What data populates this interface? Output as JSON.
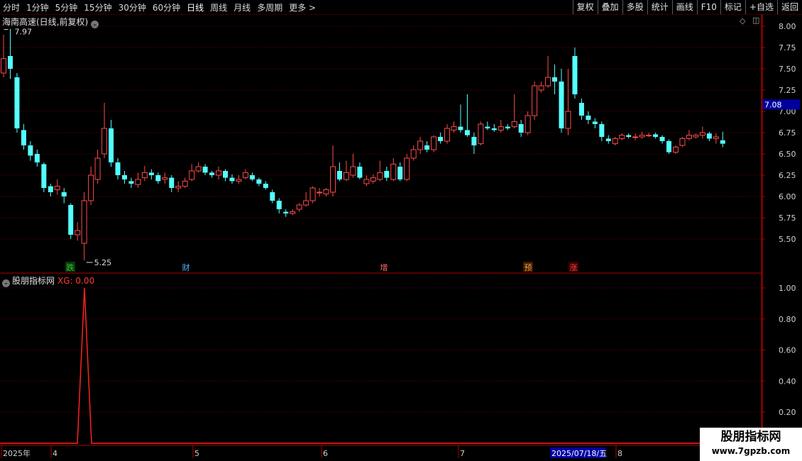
{
  "toolbar": {
    "periods": [
      "分时",
      "1分钟",
      "5分钟",
      "15分钟",
      "30分钟",
      "60分钟",
      "日线",
      "周线",
      "月线",
      "多周期",
      "更多 >"
    ],
    "active_period": "日线",
    "actions": [
      "复权",
      "叠加",
      "多股",
      "统计",
      "画线",
      "F10",
      "标记",
      "+自选",
      "返回"
    ]
  },
  "price_panel": {
    "title": "海南高速(日线,前复权)",
    "current_price_tag": "7.08",
    "high_marker": "7.97",
    "low_marker": "5.25",
    "y_ticks": [
      "8.00",
      "7.75",
      "7.50",
      "7.25",
      "7.00",
      "6.75",
      "6.50",
      "6.25",
      "6.00",
      "5.75",
      "5.50"
    ],
    "event_markers": [
      {
        "label": "跌",
        "color": "#35c635",
        "bg": "#0a3a0a"
      },
      {
        "label": "财",
        "color": "#5ab0ff",
        "bg": "#000000"
      },
      {
        "label": "增",
        "color": "#ff6b6b",
        "bg": "#000000"
      },
      {
        "label": "预",
        "color": "#ff9a3c",
        "bg": "#3a1a00"
      },
      {
        "label": "涨",
        "color": "#ff4040",
        "bg": "#3a0000"
      }
    ]
  },
  "indicator_panel": {
    "name": "股朋指标网",
    "formula": "XG: 0.00",
    "y_ticks": [
      "1.00",
      "0.80",
      "0.60",
      "0.40",
      "0.20"
    ]
  },
  "x_axis": {
    "labels": [
      "2025年",
      "4",
      "5",
      "6",
      "7",
      "8"
    ],
    "cursor_date": "2025/07/18/五"
  },
  "watermark": {
    "line1": "股朋指标网",
    "line2": "www.7gpzb.com"
  },
  "colors": {
    "up": "#ff4a4a",
    "down": "#54ffff",
    "grid": "#6a0000",
    "axis": "#b00000"
  },
  "chart_data": {
    "type": "candlestick",
    "x_start": "2025-03-10",
    "x_end": "2025-08-14",
    "ylim": [
      5.25,
      8.0
    ],
    "candles": [
      [
        7.45,
        7.62,
        7.9,
        7.4
      ],
      [
        7.65,
        7.5,
        7.97,
        7.38
      ],
      [
        7.4,
        6.8,
        7.45,
        6.75
      ],
      [
        6.78,
        6.6,
        6.85,
        6.55
      ],
      [
        6.6,
        6.48,
        6.65,
        6.42
      ],
      [
        6.5,
        6.4,
        6.55,
        6.35
      ],
      [
        6.38,
        6.1,
        6.4,
        6.05
      ],
      [
        6.12,
        6.05,
        6.15,
        6.0
      ],
      [
        6.08,
        6.12,
        6.2,
        6.02
      ],
      [
        6.05,
        6.0,
        6.1,
        5.92
      ],
      [
        5.9,
        5.55,
        5.92,
        5.5
      ],
      [
        5.55,
        5.6,
        5.7,
        5.48
      ],
      [
        5.45,
        5.95,
        6.05,
        5.25
      ],
      [
        5.95,
        6.25,
        6.35,
        5.9
      ],
      [
        6.2,
        6.45,
        6.55,
        6.15
      ],
      [
        6.5,
        6.8,
        7.1,
        6.45
      ],
      [
        6.8,
        6.4,
        6.9,
        6.35
      ],
      [
        6.4,
        6.25,
        6.45,
        6.2
      ],
      [
        6.25,
        6.2,
        6.3,
        6.15
      ],
      [
        6.18,
        6.15,
        6.22,
        6.1
      ],
      [
        6.14,
        6.2,
        6.28,
        6.1
      ],
      [
        6.22,
        6.28,
        6.36,
        6.18
      ],
      [
        6.28,
        6.25,
        6.32,
        6.2
      ],
      [
        6.25,
        6.18,
        6.28,
        6.15
      ],
      [
        6.2,
        6.22,
        6.28,
        6.15
      ],
      [
        6.22,
        6.1,
        6.25,
        6.05
      ],
      [
        6.1,
        6.12,
        6.18,
        6.05
      ],
      [
        6.12,
        6.18,
        6.22,
        6.1
      ],
      [
        6.2,
        6.3,
        6.38,
        6.18
      ],
      [
        6.3,
        6.35,
        6.4,
        6.28
      ],
      [
        6.35,
        6.28,
        6.38,
        6.25
      ],
      [
        6.28,
        6.25,
        6.3,
        6.22
      ],
      [
        6.25,
        6.3,
        6.35,
        6.2
      ],
      [
        6.3,
        6.22,
        6.32,
        6.18
      ],
      [
        6.22,
        6.18,
        6.26,
        6.15
      ],
      [
        6.18,
        6.2,
        6.25,
        6.15
      ],
      [
        6.22,
        6.28,
        6.32,
        6.2
      ],
      [
        6.25,
        6.2,
        6.28,
        6.18
      ],
      [
        6.2,
        6.15,
        6.22,
        6.12
      ],
      [
        6.15,
        6.1,
        6.18,
        6.08
      ],
      [
        6.05,
        5.95,
        6.08,
        5.92
      ],
      [
        5.95,
        5.85,
        5.98,
        5.8
      ],
      [
        5.82,
        5.8,
        5.85,
        5.76
      ],
      [
        5.8,
        5.82,
        5.85,
        5.78
      ],
      [
        5.85,
        5.9,
        5.92,
        5.82
      ],
      [
        5.9,
        5.95,
        6.05,
        5.88
      ],
      [
        5.95,
        6.1,
        6.12,
        5.92
      ],
      [
        6.05,
        6.05,
        6.1,
        6.0
      ],
      [
        6.03,
        6.08,
        6.1,
        6.0
      ],
      [
        6.05,
        6.35,
        6.6,
        6.0
      ],
      [
        6.3,
        6.2,
        6.4,
        6.18
      ],
      [
        6.2,
        6.28,
        6.42,
        6.18
      ],
      [
        6.25,
        6.35,
        6.5,
        6.22
      ],
      [
        6.35,
        6.22,
        6.4,
        6.2
      ],
      [
        6.15,
        6.2,
        6.25,
        6.12
      ],
      [
        6.18,
        6.22,
        6.26,
        6.15
      ],
      [
        6.2,
        6.28,
        6.42,
        6.18
      ],
      [
        6.3,
        6.22,
        6.35,
        6.18
      ],
      [
        6.2,
        6.38,
        6.45,
        6.18
      ],
      [
        6.35,
        6.2,
        6.4,
        6.18
      ],
      [
        6.2,
        6.45,
        6.5,
        6.18
      ],
      [
        6.45,
        6.55,
        6.6,
        6.42
      ],
      [
        6.55,
        6.65,
        6.7,
        6.5
      ],
      [
        6.6,
        6.55,
        6.65,
        6.52
      ],
      [
        6.55,
        6.7,
        6.72,
        6.52
      ],
      [
        6.7,
        6.65,
        6.75,
        6.62
      ],
      [
        6.65,
        6.8,
        6.85,
        6.62
      ],
      [
        6.78,
        6.82,
        6.88,
        6.75
      ],
      [
        6.82,
        6.78,
        7.08,
        6.75
      ],
      [
        6.78,
        6.72,
        7.2,
        6.7
      ],
      [
        6.7,
        6.6,
        6.75,
        6.5
      ],
      [
        6.62,
        6.85,
        6.88,
        6.6
      ],
      [
        6.82,
        6.8,
        6.88,
        6.78
      ],
      [
        6.8,
        6.78,
        6.85,
        6.76
      ],
      [
        6.78,
        6.82,
        6.9,
        6.75
      ],
      [
        6.82,
        6.8,
        6.85,
        6.78
      ],
      [
        6.82,
        6.88,
        7.2,
        6.8
      ],
      [
        6.85,
        6.75,
        6.9,
        6.7
      ],
      [
        6.75,
        6.95,
        7.0,
        6.72
      ],
      [
        6.95,
        7.3,
        7.35,
        6.9
      ],
      [
        7.25,
        7.3,
        7.35,
        7.22
      ],
      [
        7.3,
        7.4,
        7.65,
        7.28
      ],
      [
        7.4,
        7.35,
        7.55,
        7.2
      ],
      [
        7.35,
        6.8,
        7.5,
        6.75
      ],
      [
        6.8,
        7.0,
        7.5,
        6.72
      ],
      [
        7.65,
        7.2,
        7.75,
        7.15
      ],
      [
        7.1,
        6.95,
        7.15,
        6.9
      ],
      [
        6.95,
        6.9,
        7.0,
        6.85
      ],
      [
        6.88,
        6.85,
        6.92,
        6.8
      ],
      [
        6.85,
        6.7,
        6.88,
        6.65
      ],
      [
        6.68,
        6.65,
        6.72,
        6.62
      ],
      [
        6.62,
        6.68,
        6.7,
        6.6
      ],
      [
        6.68,
        6.72,
        6.74,
        6.66
      ],
      [
        6.72,
        6.7,
        6.74,
        6.68
      ],
      [
        6.7,
        6.7,
        6.74,
        6.66
      ],
      [
        6.7,
        6.72,
        6.76,
        6.68
      ],
      [
        6.72,
        6.72,
        6.75,
        6.7
      ],
      [
        6.73,
        6.7,
        6.75,
        6.68
      ],
      [
        6.7,
        6.65,
        6.72,
        6.62
      ],
      [
        6.65,
        6.52,
        6.67,
        6.5
      ],
      [
        6.52,
        6.58,
        6.6,
        6.5
      ],
      [
        6.6,
        6.68,
        6.7,
        6.58
      ],
      [
        6.68,
        6.72,
        6.78,
        6.66
      ],
      [
        6.7,
        6.72,
        6.74,
        6.68
      ],
      [
        6.72,
        6.75,
        6.82,
        6.68
      ],
      [
        6.74,
        6.68,
        6.76,
        6.65
      ],
      [
        6.68,
        6.7,
        6.74,
        6.62
      ],
      [
        6.66,
        6.62,
        6.76,
        6.58
      ]
    ],
    "indicator_series": {
      "name": "XG",
      "spike_value": 1.0,
      "baseline": 0.0
    }
  }
}
